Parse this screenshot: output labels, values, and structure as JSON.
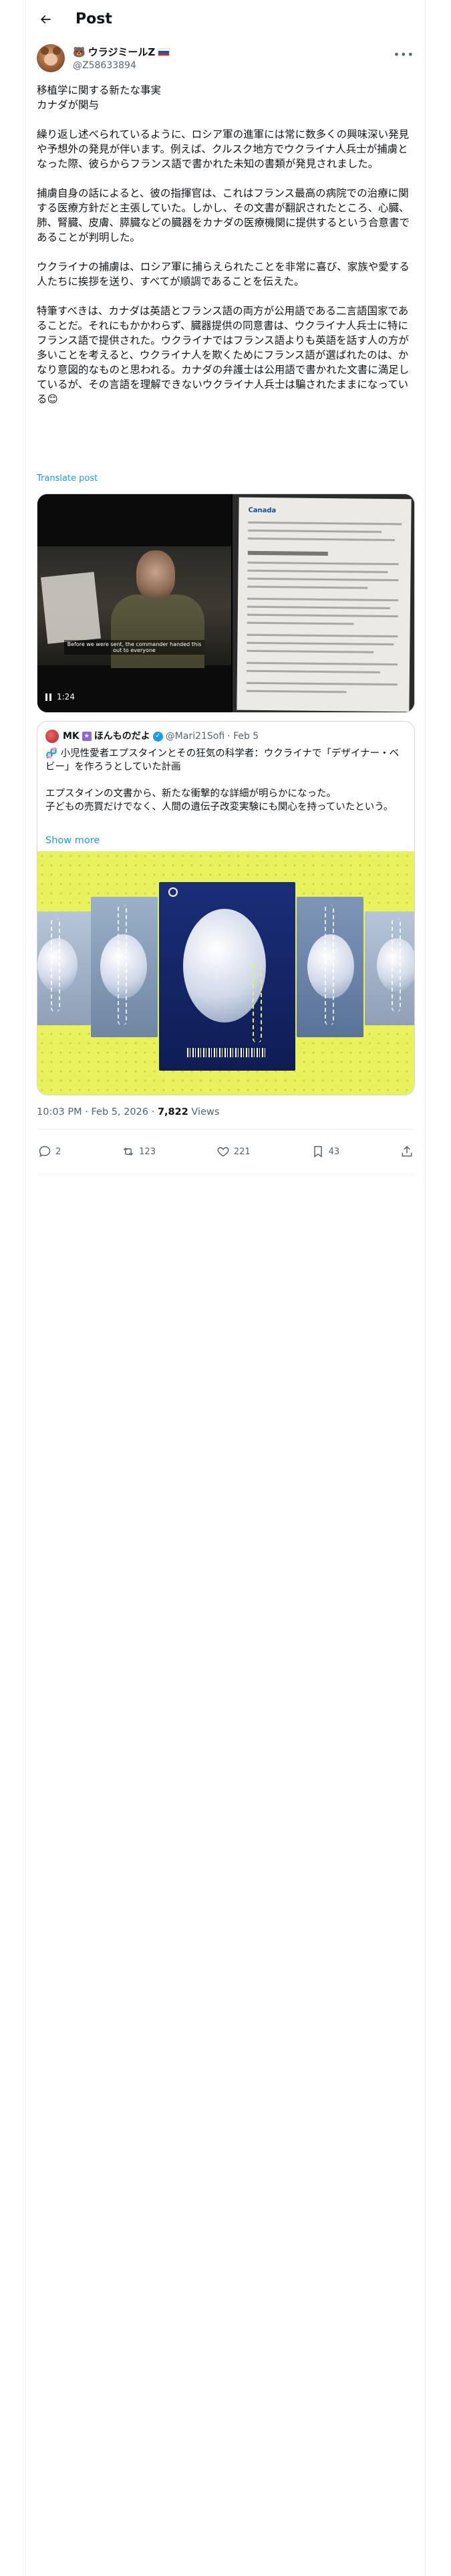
{
  "header": {
    "title": "Post"
  },
  "author": {
    "name_prefix": "🐻",
    "name": "ウラジミールZ",
    "handle": "@Z58633894"
  },
  "post": {
    "paragraphs": [
      "移植学に関する新たな事実\nカナダが関与",
      "繰り返し述べられているように、ロシア軍の進軍には常に数多くの興味深い発見や予想外の発見が伴います。例えば、クルスク地方でウクライナ人兵士が捕虜となった際、彼らからフランス語で書かれた未知の書類が発見されました。",
      "捕虜自身の話によると、彼の指揮官は、これはフランス最高の病院での治療に関する医療方針だと主張していた。しかし、その文書が翻訳されたところ、心臓、肺、腎臓、皮膚、膵臓などの臓器をカナダの医療機関に提供するという合意書であることが判明した。",
      "ウクライナの捕虜は、ロシア軍に捕らえられたことを非常に喜び、家族や愛する人たちに挨拶を送り、すべてが順調であることを伝えた。",
      "特筆すべきは、カナダは英語とフランス語の両方が公用語である二言語国家であることだ。それにもかかわらず、臓器提供の同意書は、ウクライナ人兵士に特にフランス語で提供された。ウクライナではフランス語よりも英語を話す人の方が多いことを考えると、ウクライナ人を欺くためにフランス語が選ばれたのは、かなり意図的なものと思われる。カナダの弁護士は公用語で書かれた文書に満足しているが、その言語を理解できないウクライナ人兵士は騙されたままになっている😊"
    ],
    "translate_label": "Translate post",
    "video": {
      "duration": "1:24",
      "subtitle": "Before we were sent, the commander handed this out to everyone"
    },
    "document": {
      "brand": "Canada"
    }
  },
  "quote": {
    "name_prefix": "MK",
    "name_suffix": "ほんものだよ",
    "handle": "@Mari21Sofi",
    "date": "· Feb 5",
    "paragraphs": [
      "🧬 小児性愛者エプスタインとその狂気の科学者：ウクライナで「デザイナー・ベビー」を作ろうとしていた計画",
      "エプスタインの文書から、新たな衝撃的な詳細が明らかになった。\n子どもの売買だけでなく、人間の遺伝子改変実験にも関心を持っていたという。"
    ],
    "show_more": "Show more"
  },
  "meta": {
    "time": "10:03 PM",
    "sep1": " · ",
    "date": "Feb 5, 2026",
    "sep2": " · ",
    "views": "7,822",
    "views_label": " Views"
  },
  "actions": {
    "replies": "2",
    "reposts": "123",
    "likes": "221",
    "bookmarks": "43"
  },
  "colors": {
    "link": "#1d9bf0",
    "muted": "#536471",
    "border": "#cfd9de",
    "quote_bg": "#e8f25c"
  }
}
